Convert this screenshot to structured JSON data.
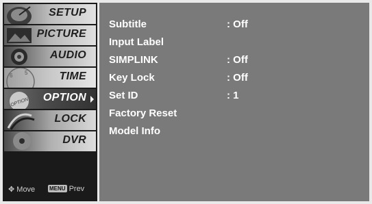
{
  "sidebar": {
    "items": [
      {
        "label": "SETUP",
        "icon": "satellite-dish-icon",
        "active": false
      },
      {
        "label": "PICTURE",
        "icon": "picture-icon",
        "active": false
      },
      {
        "label": "AUDIO",
        "icon": "speaker-icon",
        "active": false
      },
      {
        "label": "TIME",
        "icon": "clock-icon",
        "active": false
      },
      {
        "label": "OPTION",
        "icon": "option-icon",
        "active": true
      },
      {
        "label": "LOCK",
        "icon": "lock-icon",
        "active": false
      },
      {
        "label": "DVR",
        "icon": "disc-icon",
        "active": false
      }
    ],
    "hints": {
      "move_label": "Move",
      "menu_key": "MENU",
      "prev_label": "Prev"
    }
  },
  "options": [
    {
      "name": "Subtitle",
      "value": ": Off"
    },
    {
      "name": "Input Label",
      "value": ""
    },
    {
      "name": "SIMPLINK",
      "value": ": Off"
    },
    {
      "name": "Key Lock",
      "value": ": Off"
    },
    {
      "name": "Set ID",
      "value": ": 1"
    },
    {
      "name": "Factory Reset",
      "value": ""
    },
    {
      "name": "Model Info",
      "value": ""
    }
  ],
  "colors": {
    "panel_bg": "#7a7a7a",
    "sidebar_bg": "#1a1a1a",
    "active_item_bg": "#3a3a3a",
    "text": "#ffffff"
  }
}
